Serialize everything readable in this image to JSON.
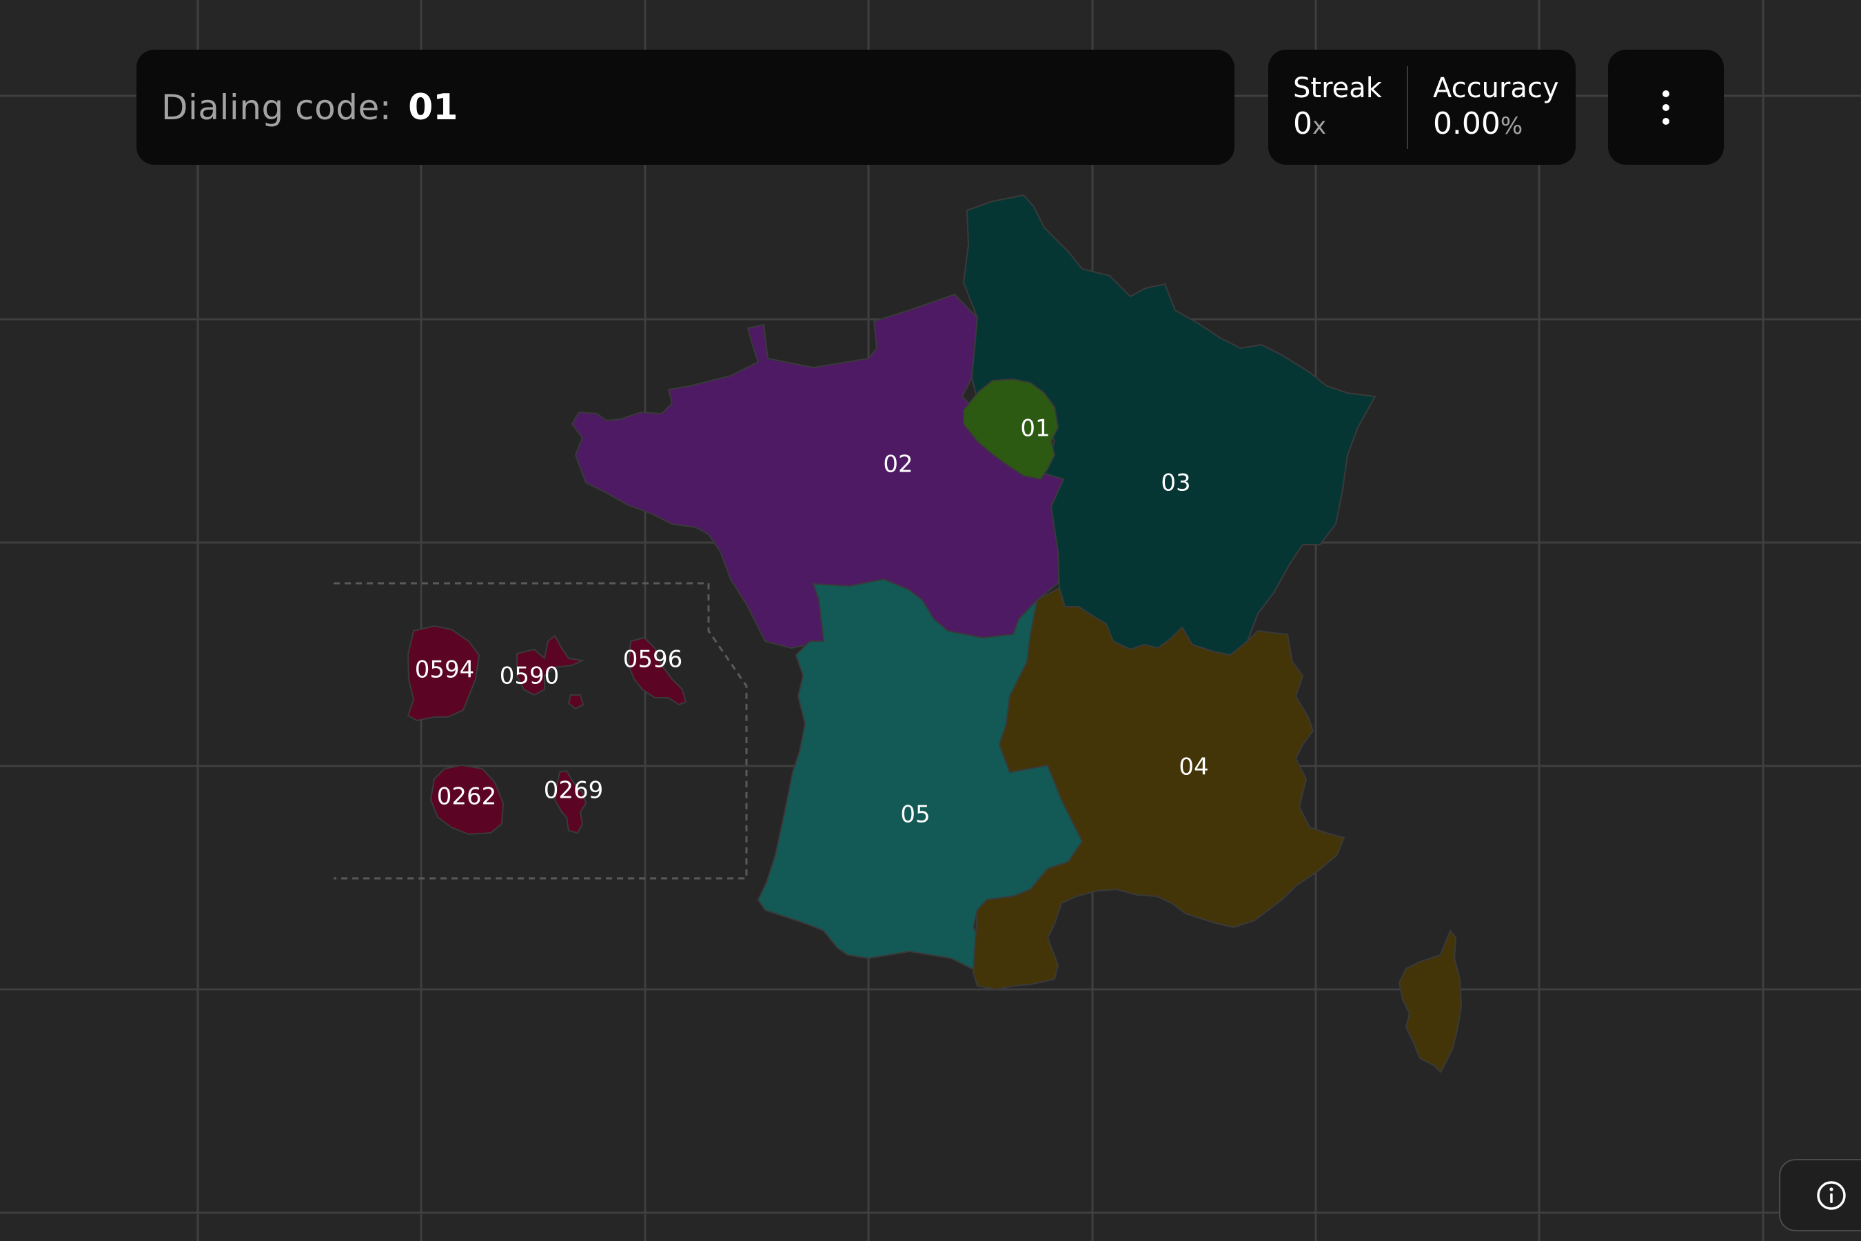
{
  "prompt": {
    "label": "Dialing code:",
    "value": "01"
  },
  "stats": {
    "streak": {
      "title": "Streak",
      "value": "0",
      "unit": "x"
    },
    "accuracy": {
      "title": "Accuracy",
      "value": "0.00",
      "unit": "%"
    }
  },
  "menu": {
    "icon": "vertical-dots-icon"
  },
  "info": {
    "icon": "info-icon"
  },
  "map": {
    "background": "#262626",
    "regions": [
      {
        "id": "01",
        "label": "01",
        "color": "#2c5a12"
      },
      {
        "id": "02",
        "label": "02",
        "color": "#4d1a63"
      },
      {
        "id": "03",
        "label": "03",
        "color": "#053634"
      },
      {
        "id": "04",
        "label": "04",
        "color": "#433508"
      },
      {
        "id": "05",
        "label": "05",
        "color": "#135955"
      },
      {
        "id": "0594",
        "label": "0594",
        "color": "#5c0423"
      },
      {
        "id": "0590",
        "label": "0590",
        "color": "#5c0423"
      },
      {
        "id": "0596",
        "label": "0596",
        "color": "#5c0423"
      },
      {
        "id": "0262",
        "label": "0262",
        "color": "#5c0423"
      },
      {
        "id": "0269",
        "label": "0269",
        "color": "#5c0423"
      }
    ]
  }
}
